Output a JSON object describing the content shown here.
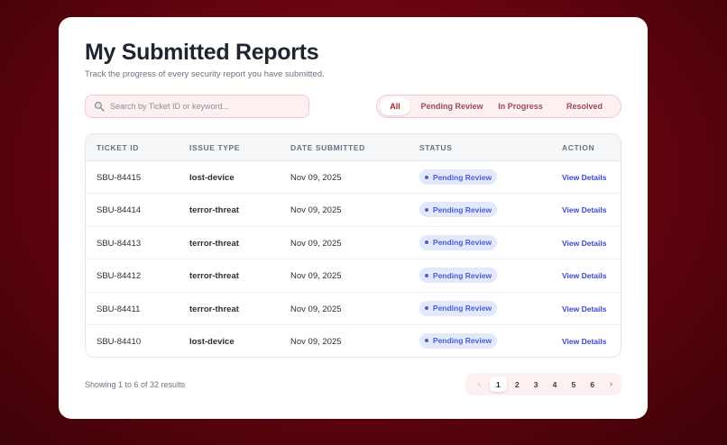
{
  "page": {
    "title": "My Submitted Reports",
    "subtitle": "Track the progress of every security report you have submitted."
  },
  "search": {
    "placeholder": "Search by Ticket ID or keyword...",
    "value": "",
    "icon": "search-icon"
  },
  "filters": [
    {
      "label": "All",
      "active": true
    },
    {
      "label": "Pending Review",
      "active": false
    },
    {
      "label": "In Progress",
      "active": false
    },
    {
      "label": "Resolved",
      "active": false
    }
  ],
  "table": {
    "columns": [
      "TICKET ID",
      "ISSUE TYPE",
      "DATE SUBMITTED",
      "STATUS",
      "ACTION"
    ],
    "rows": [
      {
        "id": "SBU-84415",
        "type": "lost-device",
        "date": "Nov 09, 2025",
        "status": "Pending Review",
        "action": "View Details"
      },
      {
        "id": "SBU-84414",
        "type": "terror-threat",
        "date": "Nov 09, 2025",
        "status": "Pending Review",
        "action": "View Details"
      },
      {
        "id": "SBU-84413",
        "type": "terror-threat",
        "date": "Nov 09, 2025",
        "status": "Pending Review",
        "action": "View Details"
      },
      {
        "id": "SBU-84412",
        "type": "terror-threat",
        "date": "Nov 09, 2025",
        "status": "Pending Review",
        "action": "View Details"
      },
      {
        "id": "SBU-84411",
        "type": "terror-threat",
        "date": "Nov 09, 2025",
        "status": "Pending Review",
        "action": "View Details"
      },
      {
        "id": "SBU-84410",
        "type": "lost-device",
        "date": "Nov 09, 2025",
        "status": "Pending Review",
        "action": "View Details"
      }
    ]
  },
  "footer": {
    "summary": "Showing 1 to 6 of 32 results"
  },
  "pagination": {
    "prev": "‹",
    "next": "›",
    "pages": [
      "1",
      "2",
      "3",
      "4",
      "5",
      "6"
    ],
    "current": "1"
  },
  "colors": {
    "background": "#6a0410",
    "accent": "#b01d2b",
    "badge_bg": "#e3e8fb",
    "badge_text": "#4a5fd3",
    "link": "#3949c9"
  }
}
